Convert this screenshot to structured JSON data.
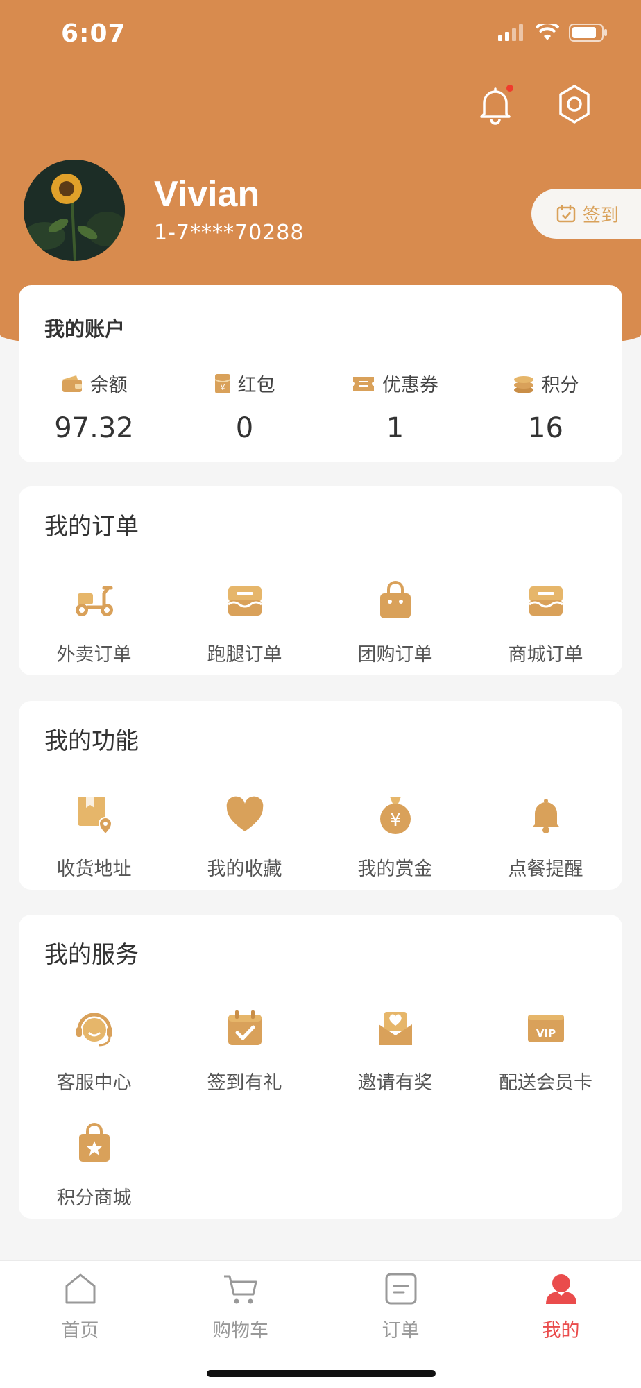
{
  "status": {
    "time": "6:07"
  },
  "colors": {
    "accent": "#d88b4e",
    "gold": "#d9a15a",
    "active": "#ea4c4c"
  },
  "profile": {
    "name": "Vivian",
    "phone": "1-7****70288",
    "checkin_label": "签到"
  },
  "account": {
    "title": "我的账户",
    "items": [
      {
        "label": "余额",
        "value": "97.32",
        "icon": "wallet-icon"
      },
      {
        "label": "红包",
        "value": "0",
        "icon": "red-packet-icon"
      },
      {
        "label": "优惠券",
        "value": "1",
        "icon": "coupon-icon"
      },
      {
        "label": "积分",
        "value": "16",
        "icon": "coins-icon"
      }
    ]
  },
  "orders": {
    "title": "我的订单",
    "items": [
      {
        "label": "外卖订单",
        "icon": "scooter-icon"
      },
      {
        "label": "跑腿订单",
        "icon": "box-icon"
      },
      {
        "label": "团购订单",
        "icon": "shopping-bag-icon"
      },
      {
        "label": "商城订单",
        "icon": "store-box-icon"
      }
    ]
  },
  "functions": {
    "title": "我的功能",
    "items": [
      {
        "label": "收货地址",
        "icon": "address-icon"
      },
      {
        "label": "我的收藏",
        "icon": "heart-icon"
      },
      {
        "label": "我的赏金",
        "icon": "money-bag-icon"
      },
      {
        "label": "点餐提醒",
        "icon": "bell-icon"
      }
    ]
  },
  "services": {
    "title": "我的服务",
    "items": [
      {
        "label": "客服中心",
        "icon": "headset-icon"
      },
      {
        "label": "签到有礼",
        "icon": "calendar-check-icon"
      },
      {
        "label": "邀请有奖",
        "icon": "invite-letter-icon"
      },
      {
        "label": "配送会员卡",
        "icon": "vip-card-icon",
        "badge": "VIP"
      },
      {
        "label": "积分商城",
        "icon": "star-bag-icon"
      }
    ]
  },
  "tabbar": [
    {
      "label": "首页",
      "icon": "home-icon"
    },
    {
      "label": "购物车",
      "icon": "cart-icon"
    },
    {
      "label": "订单",
      "icon": "order-list-icon"
    },
    {
      "label": "我的",
      "icon": "user-icon",
      "active": true
    }
  ]
}
